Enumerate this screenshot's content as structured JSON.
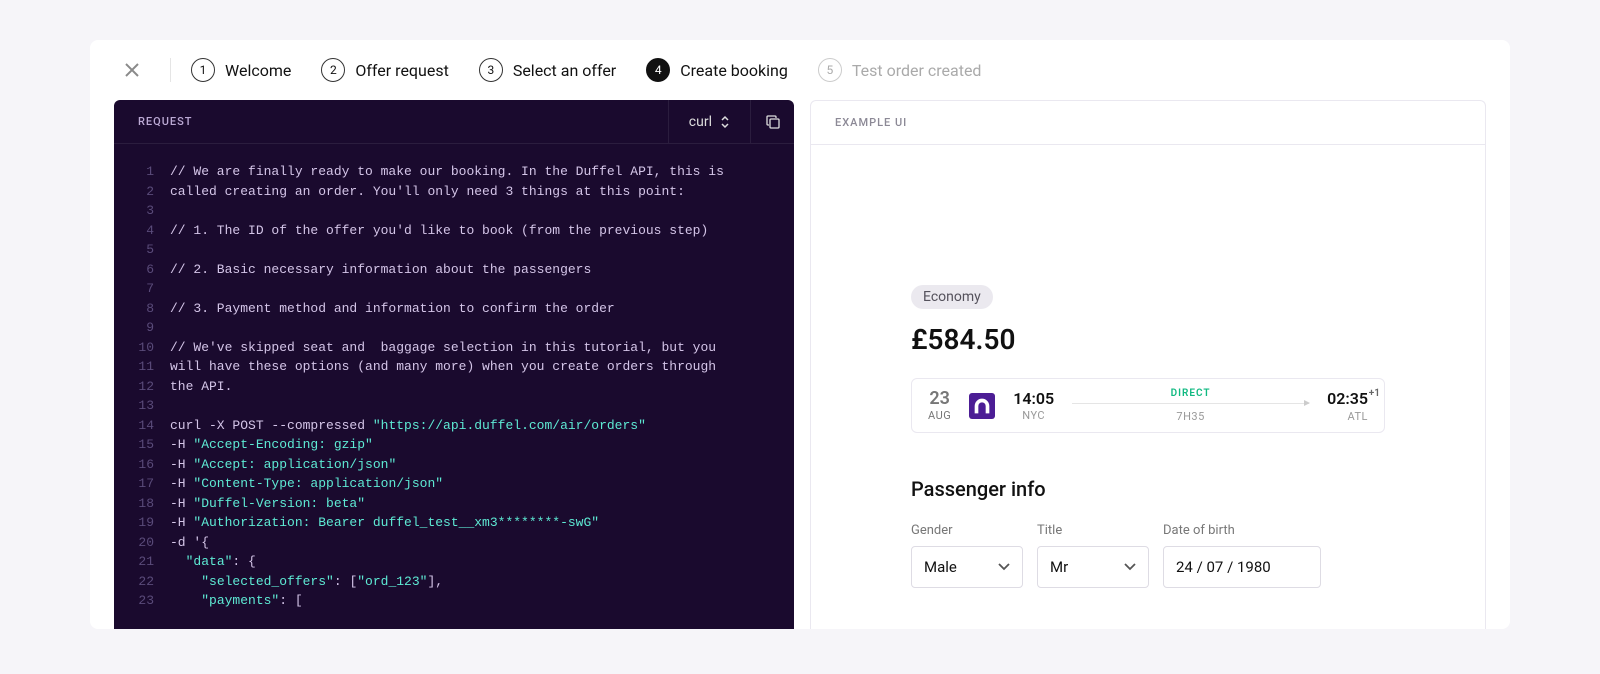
{
  "stepper": {
    "steps": [
      {
        "num": "1",
        "label": "Welcome",
        "state": "normal"
      },
      {
        "num": "2",
        "label": "Offer request",
        "state": "normal"
      },
      {
        "num": "3",
        "label": "Select an offer",
        "state": "normal"
      },
      {
        "num": "4",
        "label": "Create booking",
        "state": "active"
      },
      {
        "num": "5",
        "label": "Test order created",
        "state": "disabled"
      }
    ]
  },
  "code": {
    "header_title": "REQUEST",
    "language": "curl",
    "lines": [
      {
        "n": "1",
        "type": "comment",
        "text": "// We are finally ready to make our booking. In the Duffel API, this is"
      },
      {
        "n": "2",
        "type": "comment",
        "text": "called creating an order. You'll only need 3 things at this point:"
      },
      {
        "n": "3",
        "type": "blank",
        "text": ""
      },
      {
        "n": "4",
        "type": "comment",
        "text": "// 1. The ID of the offer you'd like to book (from the previous step)"
      },
      {
        "n": "5",
        "type": "blank",
        "text": ""
      },
      {
        "n": "6",
        "type": "comment",
        "text": "// 2. Basic necessary information about the passengers"
      },
      {
        "n": "7",
        "type": "blank",
        "text": ""
      },
      {
        "n": "8",
        "type": "comment",
        "text": "// 3. Payment method and information to confirm the order"
      },
      {
        "n": "9",
        "type": "blank",
        "text": ""
      },
      {
        "n": "10",
        "type": "comment",
        "text": "// We've skipped seat and  baggage selection in this tutorial, but you"
      },
      {
        "n": "11",
        "type": "comment",
        "text": "will have these options (and many more) when you create orders through"
      },
      {
        "n": "12",
        "type": "comment",
        "text": "the API."
      },
      {
        "n": "13",
        "type": "blank",
        "text": ""
      },
      {
        "n": "14",
        "type": "curl",
        "cmd": "curl -X POST --compressed ",
        "str": "\"https://api.duffel.com/air/orders\""
      },
      {
        "n": "15",
        "type": "flag",
        "cmd": "-H ",
        "str": "\"Accept-Encoding: gzip\""
      },
      {
        "n": "16",
        "type": "flag",
        "cmd": "-H ",
        "str": "\"Accept: application/json\""
      },
      {
        "n": "17",
        "type": "flag",
        "cmd": "-H ",
        "str": "\"Content-Type: application/json\""
      },
      {
        "n": "18",
        "type": "flag",
        "cmd": "-H ",
        "str": "\"Duffel-Version: beta\""
      },
      {
        "n": "19",
        "type": "flag",
        "cmd": "-H ",
        "str": "\"Authorization: Bearer duffel_test__xm3********-swG\""
      },
      {
        "n": "20",
        "type": "cmd",
        "text": "-d '{"
      },
      {
        "n": "21",
        "type": "json",
        "indent": 1,
        "str": "\"data\"",
        "after": ": {"
      },
      {
        "n": "22",
        "type": "json",
        "indent": 2,
        "str": "\"selected_offers\"",
        "after": ": [",
        "str2": "\"ord_123\"",
        "after2": "],"
      },
      {
        "n": "23",
        "type": "json",
        "indent": 2,
        "str": "\"payments\"",
        "after": ": ["
      }
    ]
  },
  "example": {
    "header_title": "EXAMPLE UI",
    "fare_class": "Economy",
    "price": "£584.50",
    "flight": {
      "date_day": "23",
      "date_month": "AUG",
      "dep_time": "14:05",
      "dep_loc": "NYC",
      "direct_label": "DIRECT",
      "duration": "7H35",
      "arr_time": "02:35",
      "arr_plus": "+1",
      "arr_loc": "ATL"
    },
    "passenger": {
      "section_title": "Passenger info",
      "gender_label": "Gender",
      "gender_value": "Male",
      "title_label": "Title",
      "title_value": "Mr",
      "dob_label": "Date of birth",
      "dob_value": "24 / 07 / 1980"
    }
  }
}
